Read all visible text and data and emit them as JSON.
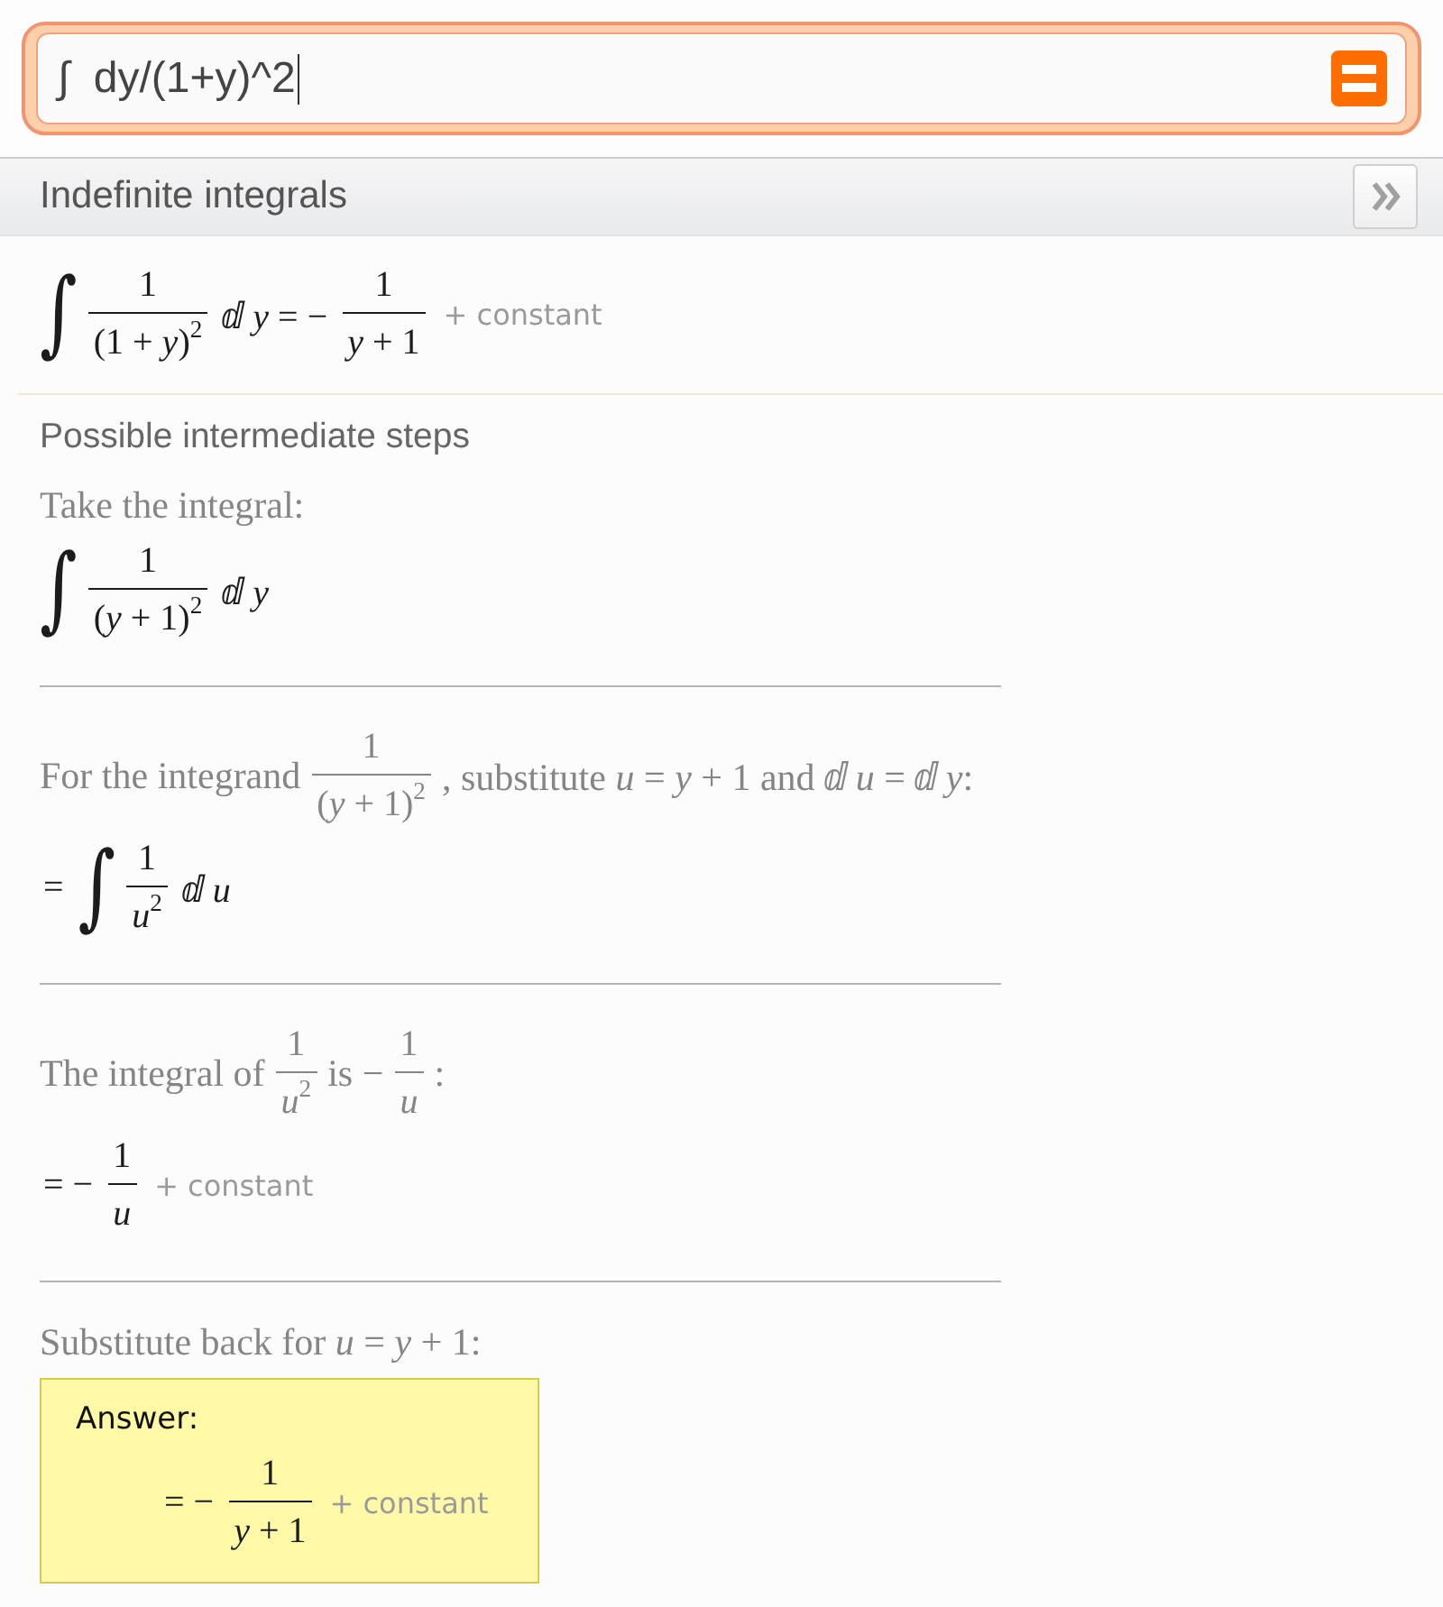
{
  "search": {
    "value": "∫  dy/(1+y)^2"
  },
  "pod": {
    "title": "Indefinite integrals",
    "result": [
      {
        "kind": "integral",
        "text": "∫"
      },
      {
        "kind": "fraction",
        "num": "1",
        "den": "(1 + *y*)$^{2}$"
      },
      {
        "kind": "math",
        "text": "ⅆ *y* = −"
      },
      {
        "kind": "fraction",
        "num": "1",
        "den": "*y* + 1"
      },
      {
        "kind": "note",
        "text": "+ constant"
      }
    ]
  },
  "steps": {
    "title": "Possible intermediate steps",
    "items": [
      {
        "intro": [
          {
            "kind": "prose",
            "text": "Take the integral:"
          }
        ],
        "result": [
          {
            "kind": "integral",
            "text": "∫"
          },
          {
            "kind": "fraction",
            "num": "1",
            "den": "(*y* + 1)$^{2}$"
          },
          {
            "kind": "math",
            "text": "ⅆ *y*"
          }
        ]
      },
      {
        "intro": [
          {
            "kind": "prose",
            "text": "For the integrand"
          },
          {
            "kind": "fraction",
            "num": "1",
            "den": "(*y* + 1)$^{2}$"
          },
          {
            "kind": "prose",
            "text": ", substitute *u* = *y* + 1 and ⅆ *u* = ⅆ *y*:"
          }
        ],
        "result": [
          {
            "kind": "math",
            "text": "="
          },
          {
            "kind": "integral",
            "text": "∫"
          },
          {
            "kind": "fraction",
            "num": "1",
            "den": "*u*$^{2}$"
          },
          {
            "kind": "math",
            "text": "ⅆ *u*"
          }
        ]
      },
      {
        "intro": [
          {
            "kind": "prose",
            "text": "The integral of"
          },
          {
            "kind": "fraction",
            "num": "1",
            "den": "*u*$^{2}$"
          },
          {
            "kind": "prose",
            "text": "is −"
          },
          {
            "kind": "fraction",
            "num": "1",
            "den": "*u*"
          },
          {
            "kind": "prose",
            "text": ":"
          }
        ],
        "result": [
          {
            "kind": "math",
            "text": "= −"
          },
          {
            "kind": "fraction",
            "num": "1",
            "den": "*u*"
          },
          {
            "kind": "note",
            "text": "+ constant"
          }
        ]
      },
      {
        "intro": [
          {
            "kind": "prose",
            "text": "Substitute back for *u* = *y* + 1:"
          }
        ],
        "answer": {
          "label": "Answer:",
          "math": [
            {
              "kind": "math",
              "text": "= −"
            },
            {
              "kind": "fraction",
              "num": "1",
              "den": "*y* + 1"
            },
            {
              "kind": "note",
              "text": "+ constant"
            }
          ]
        }
      }
    ]
  }
}
